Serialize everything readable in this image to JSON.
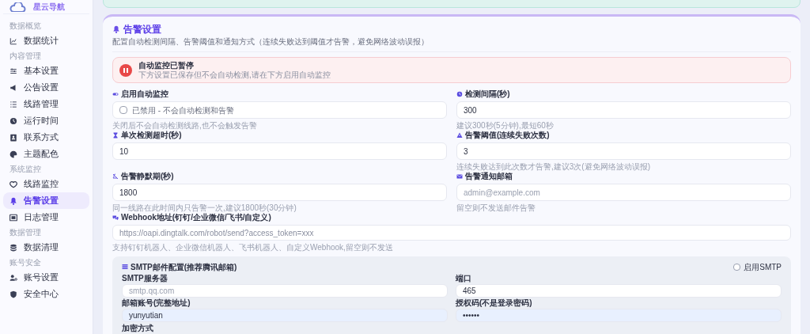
{
  "logo": {
    "text": "星云导航"
  },
  "sidebar": {
    "groups": [
      {
        "title": "数据概览",
        "items": [
          {
            "label": "数据统计",
            "selected": false
          }
        ]
      },
      {
        "title": "内容管理",
        "items": [
          {
            "label": "基本设置",
            "selected": false
          },
          {
            "label": "公告设置",
            "selected": false
          },
          {
            "label": "线路管理",
            "selected": false
          },
          {
            "label": "运行时间",
            "selected": false
          },
          {
            "label": "联系方式",
            "selected": false
          },
          {
            "label": "主题配色",
            "selected": false
          }
        ]
      },
      {
        "title": "系统监控",
        "items": [
          {
            "label": "线路监控",
            "selected": false
          },
          {
            "label": "告警设置",
            "selected": true
          },
          {
            "label": "日志管理",
            "selected": false
          }
        ]
      },
      {
        "title": "数据管理",
        "items": [
          {
            "label": "数据清理",
            "selected": false
          }
        ]
      },
      {
        "title": "账号安全",
        "items": [
          {
            "label": "账号设置",
            "selected": false
          },
          {
            "label": "安全中心",
            "selected": false
          }
        ]
      }
    ]
  },
  "panel": {
    "title": "告警设置",
    "description": "配置自动检测间隔、告警阈值和通知方式（连续失败达到阈值才告警，避免网络波动误报）",
    "alert": {
      "title": "自动监控已暂停",
      "text": "下方设置已保存但不会自动检测,请在下方启用自动监控"
    },
    "fields": [
      {
        "kind": "checkbox",
        "label": "启用自动监控",
        "checked": false,
        "text": "已禁用 - 不会自动检测和告警",
        "hint": "关闭后不会自动检测线路,也不会触发告警"
      },
      {
        "kind": "input",
        "label": "检测间隔(秒)",
        "value": "300",
        "hint": "建议300秒(5分钟),最短60秒"
      },
      {
        "kind": "input",
        "label": "单次检测超时(秒)",
        "value": "10"
      },
      {
        "kind": "input",
        "label": "告警阈值(连续失败次数)",
        "value": "3",
        "hint": "连续失败达到此次数才告警,建议3次(避免网络波动误报)"
      },
      {
        "kind": "input",
        "label": "告警静默期(秒)",
        "value": "1800",
        "hint": "同一线路在此时间内只告警一次,建议1800秒(30分钟)"
      },
      {
        "kind": "input",
        "label": "告警通知邮箱",
        "placeholder": "admin@example.com",
        "hint": "留空则不发送邮件告警"
      }
    ],
    "webhook": {
      "label": "Webhook地址(钉钉/企业微信/飞书/自定义)",
      "placeholder": "https://oapi.dingtalk.com/robot/send?access_token=xxx",
      "hint": "支持钉钉机器人、企业微信机器人、飞书机器人、自定义Webhook,留空则不发送"
    },
    "smtp": {
      "title": "SMTP邮件配置(推荐腾讯邮箱)",
      "enable": {
        "label": "启用SMTP",
        "checked": false
      },
      "fields": [
        {
          "label": "SMTP服务器",
          "placeholder": "smtp.qq.com",
          "autofilled": false
        },
        {
          "label": "端口",
          "value": "465",
          "autofilled": false
        },
        {
          "label": "邮箱账号(完整地址)",
          "value": "yunyutian",
          "autofilled": true
        },
        {
          "label": "授权码(不是登录密码)",
          "value": "••••••",
          "autofilled": true
        }
      ],
      "next_label": "加密方式"
    }
  }
}
